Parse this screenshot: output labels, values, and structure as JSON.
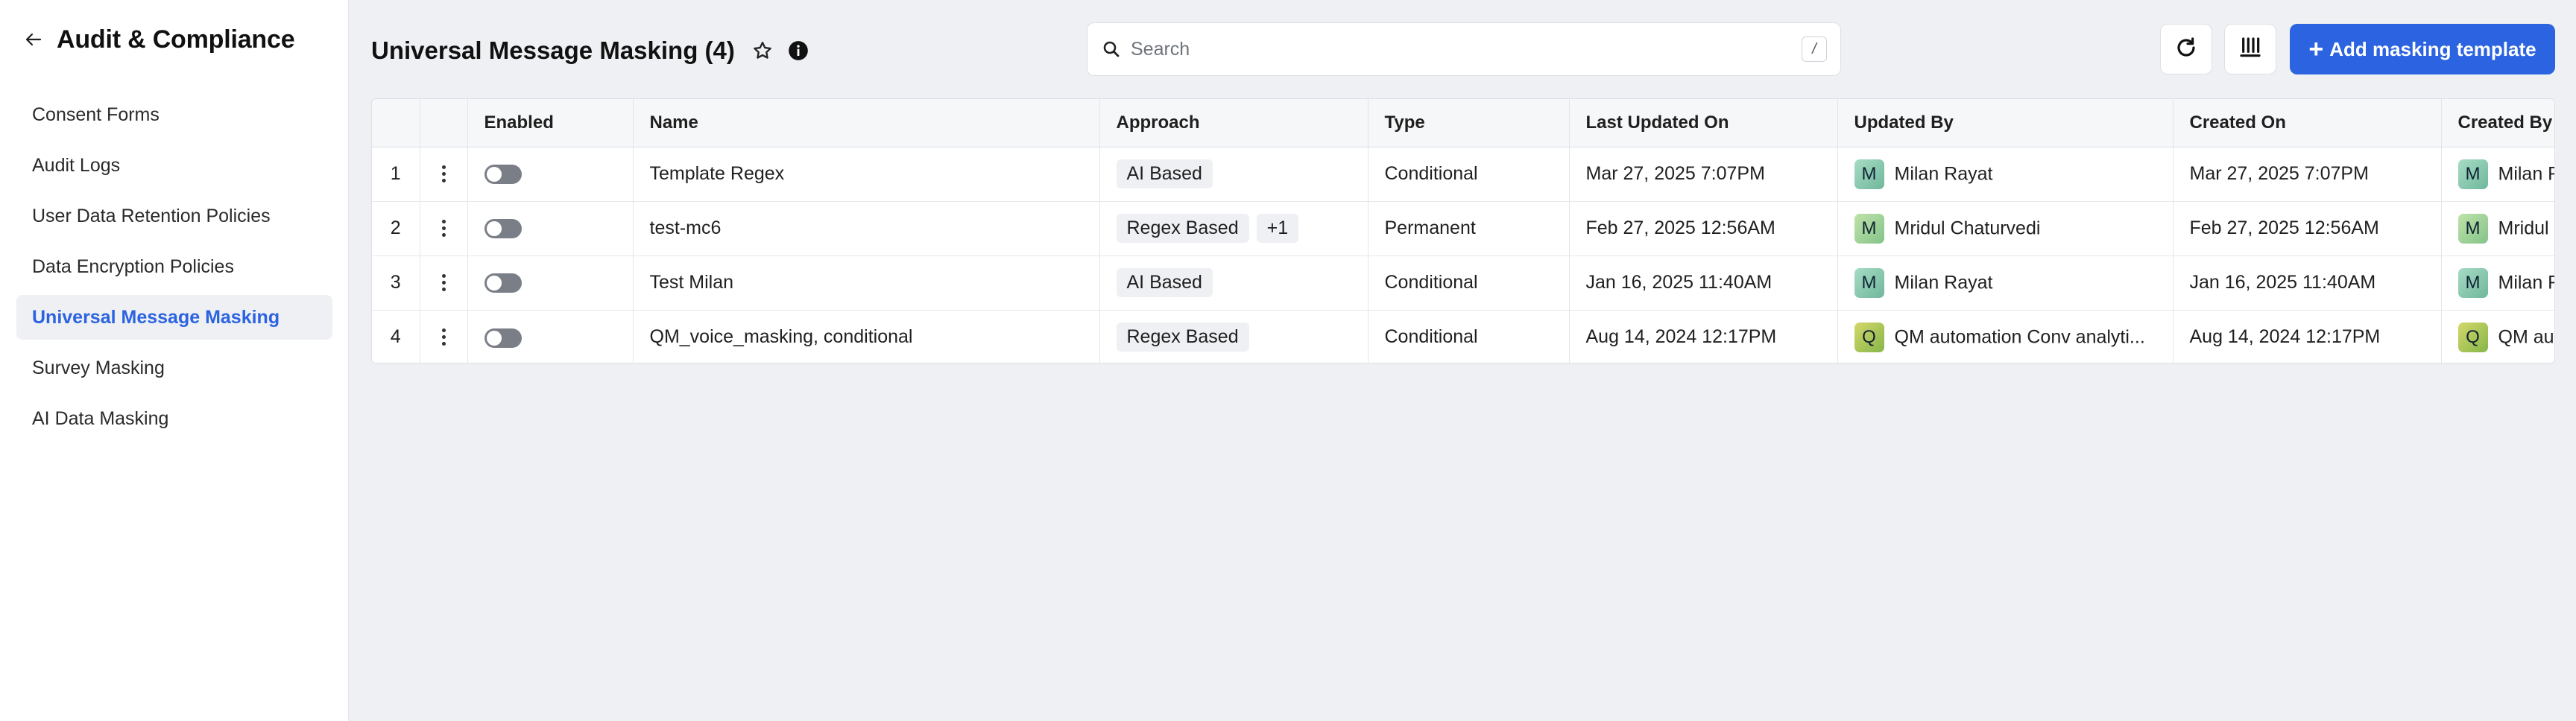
{
  "sidebar": {
    "title": "Audit & Compliance",
    "back_icon": "arrow-left-icon",
    "items": [
      {
        "label": "Consent Forms"
      },
      {
        "label": "Audit Logs"
      },
      {
        "label": "User Data Retention Policies"
      },
      {
        "label": "Data Encryption Policies"
      },
      {
        "label": "Universal Message Masking",
        "active": true
      },
      {
        "label": "Survey Masking"
      },
      {
        "label": "AI Data Masking"
      }
    ]
  },
  "header": {
    "title": "Universal Message Masking (4)",
    "star_icon": "star-icon",
    "info_icon": "info-icon"
  },
  "search": {
    "placeholder": "Search",
    "value": "",
    "shortcut": "/"
  },
  "toolbar": {
    "refresh_icon": "refresh-icon",
    "columns_icon": "columns-icon",
    "add_label": "Add masking template",
    "add_prefix": "+"
  },
  "colors": {
    "accent": "#2b63e0",
    "avatar_m": "#8fd1b8",
    "avatar_q": "#b7cf5a"
  },
  "table": {
    "columns": [
      "",
      "",
      "Enabled",
      "Name",
      "Approach",
      "Type",
      "Last Updated On",
      "Updated By",
      "Created On",
      "Created By"
    ],
    "rows": [
      {
        "index": "1",
        "enabled": false,
        "name": "Template Regex",
        "approach": [
          "AI Based"
        ],
        "type": "Conditional",
        "last_updated_on": "Mar 27, 2025 7:07PM",
        "updated_by": {
          "initial": "M",
          "name": "Milan Rayat"
        },
        "created_on": "Mar 27, 2025 7:07PM",
        "created_by": {
          "initial": "M",
          "name": "Milan Rayat"
        }
      },
      {
        "index": "2",
        "enabled": false,
        "name": "test-mc6",
        "approach": [
          "Regex Based",
          "+1"
        ],
        "type": "Permanent",
        "last_updated_on": "Feb 27, 2025 12:56AM",
        "updated_by": {
          "initial": "M",
          "name": "Mridul Chaturvedi"
        },
        "created_on": "Feb 27, 2025 12:56AM",
        "created_by": {
          "initial": "M",
          "name": "Mridul Chaturvedi"
        }
      },
      {
        "index": "3",
        "enabled": false,
        "name": "Test Milan",
        "approach": [
          "AI Based"
        ],
        "type": "Conditional",
        "last_updated_on": "Jan 16, 2025 11:40AM",
        "updated_by": {
          "initial": "M",
          "name": "Milan Rayat"
        },
        "created_on": "Jan 16, 2025 11:40AM",
        "created_by": {
          "initial": "M",
          "name": "Milan Rayat"
        }
      },
      {
        "index": "4",
        "enabled": false,
        "name": "QM_voice_masking, conditional",
        "approach": [
          "Regex Based"
        ],
        "type": "Conditional",
        "last_updated_on": "Aug 14, 2024 12:17PM",
        "updated_by": {
          "initial": "Q",
          "name": "QM automation Conv analyti..."
        },
        "created_on": "Aug 14, 2024 12:17PM",
        "created_by": {
          "initial": "Q",
          "name": "QM automation Conv analytics"
        }
      }
    ]
  }
}
